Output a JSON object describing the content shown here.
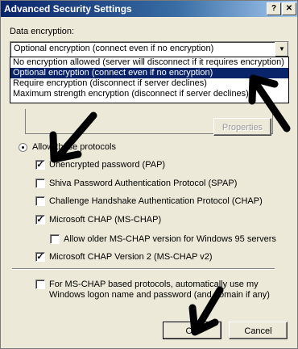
{
  "window": {
    "title": "Advanced Security Settings",
    "help_btn": "?",
    "close_btn": "✕"
  },
  "data_encryption": {
    "label": "Data encryption:",
    "selected": "Optional encryption (connect even if no encryption)",
    "options": [
      "No encryption allowed (server will disconnect if it requires encryption)",
      "Optional encryption (connect even if no encryption)",
      "Require encryption (disconnect if server declines)",
      "Maximum strength encryption (disconnect if server declines)"
    ],
    "selected_index": 1
  },
  "properties_button": "Properties",
  "protocols": {
    "radio_label": "Allow these protocols",
    "items": [
      {
        "label": "Unencrypted password (PAP)",
        "checked": true
      },
      {
        "label": "Shiva Password Authentication Protocol (SPAP)",
        "checked": false
      },
      {
        "label": "Challenge Handshake Authentication Protocol (CHAP)",
        "checked": false
      },
      {
        "label": "Microsoft CHAP (MS-CHAP)",
        "checked": true
      },
      {
        "label": "Allow older MS-CHAP version for Windows 95 servers",
        "checked": false
      },
      {
        "label": "Microsoft CHAP Version 2 (MS-CHAP v2)",
        "checked": true
      }
    ]
  },
  "logon": {
    "line1": "For MS-CHAP based protocols, automatically use my",
    "line2": "Windows logon name and password (and domain if any)",
    "checked": false
  },
  "buttons": {
    "ok": "OK",
    "cancel": "Cancel"
  },
  "annotation_color": "#000000"
}
